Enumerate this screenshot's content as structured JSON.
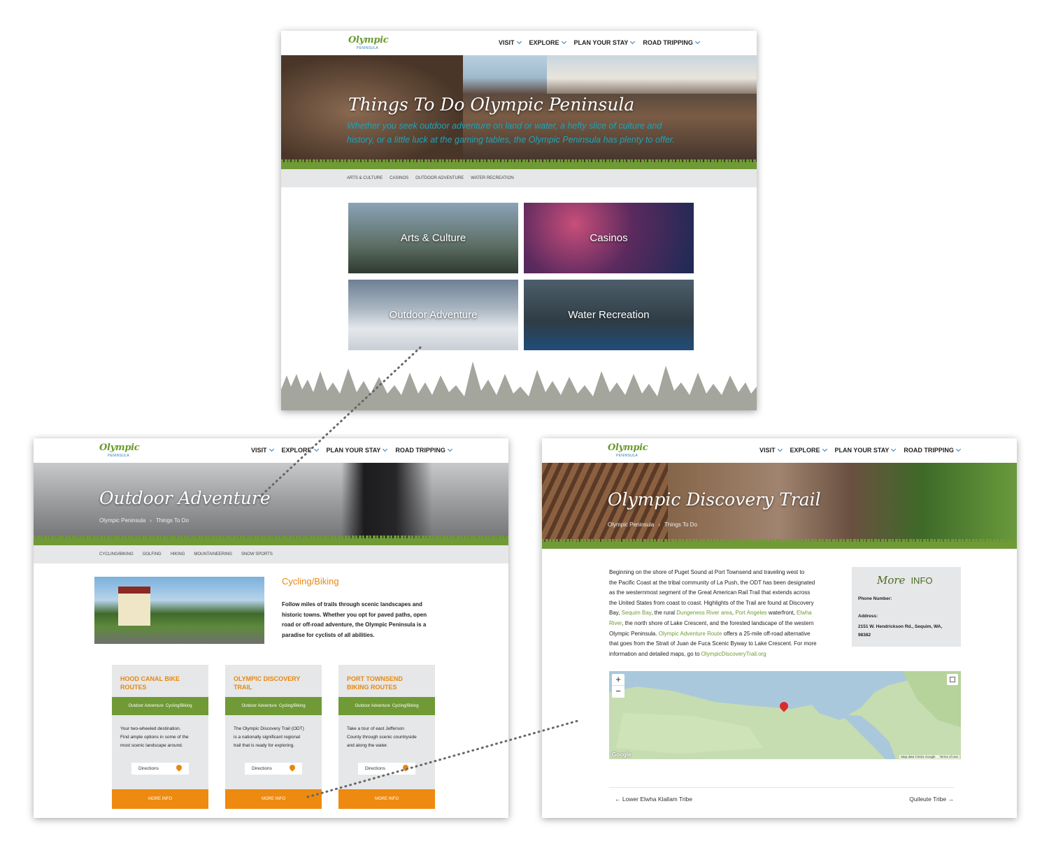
{
  "logo": {
    "name": "Olympic",
    "sub": "PENINSULA"
  },
  "nav": [
    "VISIT",
    "EXPLORE",
    "PLAN YOUR STAY",
    "ROAD TRIPPING"
  ],
  "panel_main": {
    "title": "Things To Do Olympic Peninsula",
    "tagline_1": "Whether you seek outdoor adventure on land or water, a hefty slice of culture and",
    "tagline_2": "history, or a little luck at the gaming tables, the Olympic Peninsula has plenty to offer.",
    "subnav": [
      "ARTS & CULTURE",
      "CASINOS",
      "OUTDOOR ADVENTURE",
      "WATER RECREATION"
    ],
    "tiles": [
      "Arts & Culture",
      "Casinos",
      "Outdoor Adventure",
      "Water Recreation"
    ]
  },
  "panel_adventure": {
    "title": "Outdoor Adventure",
    "breadcrumb": [
      "Olympic Peninsula",
      "Things To Do"
    ],
    "subnav": [
      "CYCLING/BIKING",
      "GOLFING",
      "HIKING",
      "MOUNTAINEERING",
      "SNOW SPORTS"
    ],
    "section_title": "Cycling/Biking",
    "section_text": [
      "Follow miles of trails through scenic landscapes and",
      "historic towns. Whether you opt for paved paths, open",
      "road or off-road adventure, the Olympic Peninsula is a",
      "paradise for cyclists of all abilities."
    ],
    "cards": [
      {
        "title_1": "HOOD CANAL BIKE",
        "title_2": "ROUTES",
        "tag_1": "Outdoor Adventure",
        "tag_2": "Cycling/Biking",
        "desc": [
          "Your two-wheeled destination.",
          "Find ample options in some of the",
          "most scenic landscape around."
        ],
        "directions": "Directions",
        "more": "MORE INFO"
      },
      {
        "title_1": "OLYMPIC DISCOVERY",
        "title_2": "TRAIL",
        "tag_1": "Outdoor Adventure",
        "tag_2": "Cycling/Biking",
        "desc": [
          "The Olympic Discovery Trail (ODT)",
          "is a nationally significant regional",
          "trail that is ready for exploring."
        ],
        "directions": "Directions",
        "more": "MORE INFO"
      },
      {
        "title_1": "PORT TOWNSEND",
        "title_2": "BIKING ROUTES",
        "tag_1": "Outdoor Adventure",
        "tag_2": "Cycling/Biking",
        "desc": [
          "Take a tour of east Jefferson",
          "County through scenic countryside",
          "and along the water."
        ],
        "directions": "Directions",
        "more": "MORE INFO"
      }
    ]
  },
  "panel_trail": {
    "title": "Olympic Discovery Trail",
    "breadcrumb": [
      "Olympic Peninsula",
      "Things To Do"
    ],
    "body": {
      "l1": "Beginning on the shore of Puget Sound at Port Townsend and traveling west to",
      "l2": "the Pacific Coast at the tribal community of La Push, the ODT has been designated",
      "l3": "as the westernmost segment of the Great American Rail Trail that extends across",
      "l4": "the United States from coast to coast. Highlights of the Trail are found at Discovery",
      "l5a": "Bay,",
      "l5_link1": "Sequim Bay",
      "l5b": ", the rural",
      "l5_link2": "Dungeness River area",
      "l5c": ",",
      "l5_link3": "Port Angeles",
      "l5d": "waterfront,",
      "l5_link4": "Elwha",
      "l6_link": "River",
      "l6": ", the north shore of Lake Crescent, and the forested landscape of the western",
      "l7a": "Olympic Peninsula.",
      "l7_link": "Olympic Adventure Route",
      "l7b": "offers a 25-mile off-road alternative",
      "l8": "that goes from the Strait of Juan de Fuca Scenic Byway to Lake Crescent. For more",
      "l9a": "information and detailed maps, go to",
      "l9_link": "OlympicDiscoveryTrail.org"
    },
    "info": {
      "title_script": "More",
      "title": "INFO",
      "phone_label": "Phone Number:",
      "address_label": "Address:",
      "address_1": "2151 W. Hendrickson Rd., Sequim, WA,",
      "address_2": "98382"
    },
    "map": {
      "google": "Google",
      "attribution": "Map data ©2021 Google",
      "terms": "Terms of Use",
      "zoom_in": "+",
      "zoom_out": "−"
    },
    "prev": "← Lower Elwha Klallam Tribe",
    "next": "Quileute Tribe →"
  },
  "colors": {
    "green": "#6f9a35",
    "orange": "#ee8a0f",
    "teal": "#1ea3b8",
    "gray": "#e6e7e8"
  }
}
